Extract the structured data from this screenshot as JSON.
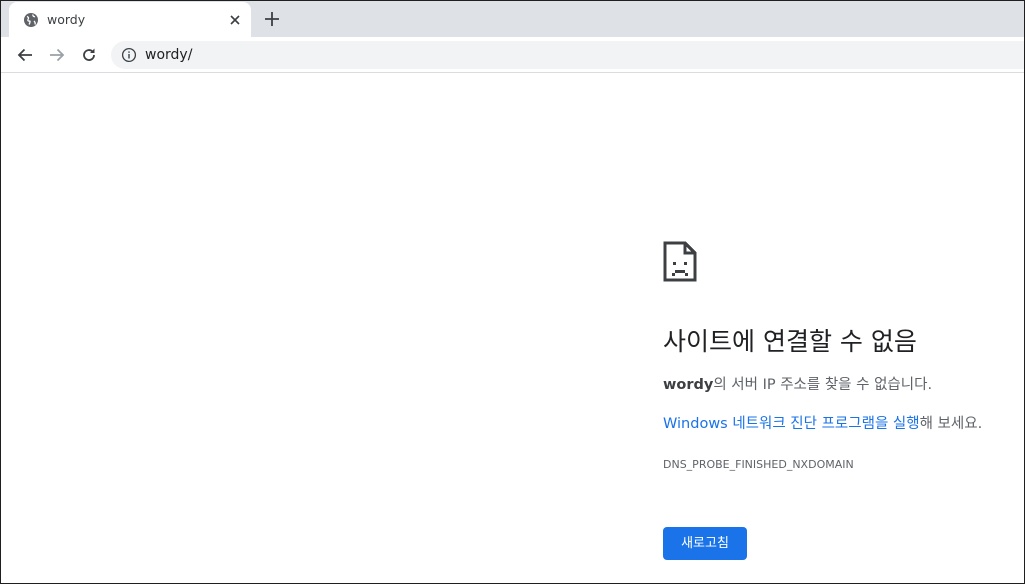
{
  "tab": {
    "title": "wordy",
    "favicon": "globe-icon",
    "close_icon": "close-icon",
    "new_tab_icon": "plus-icon"
  },
  "toolbar": {
    "back_icon": "arrow-left-icon",
    "forward_icon": "arrow-right-icon",
    "reload_icon": "reload-icon",
    "info_icon": "info-icon",
    "url": "wordy/"
  },
  "error": {
    "icon": "sad-document-icon",
    "title": "사이트에 연결할 수 없음",
    "host": "wordy",
    "desc_suffix": "의 서버 IP 주소를 찾을 수 없습니다.",
    "suggest_link": "Windows 네트워크 진단 프로그램을 실행",
    "suggest_suffix": "해 보세요.",
    "code": "DNS_PROBE_FINISHED_NXDOMAIN",
    "reload_label": "새로고침"
  },
  "colors": {
    "accent": "#1a73e8",
    "tabstrip": "#dee1e6",
    "omnibox": "#f1f3f4",
    "title_text": "#202124",
    "secondary_text": "#5f6368"
  }
}
